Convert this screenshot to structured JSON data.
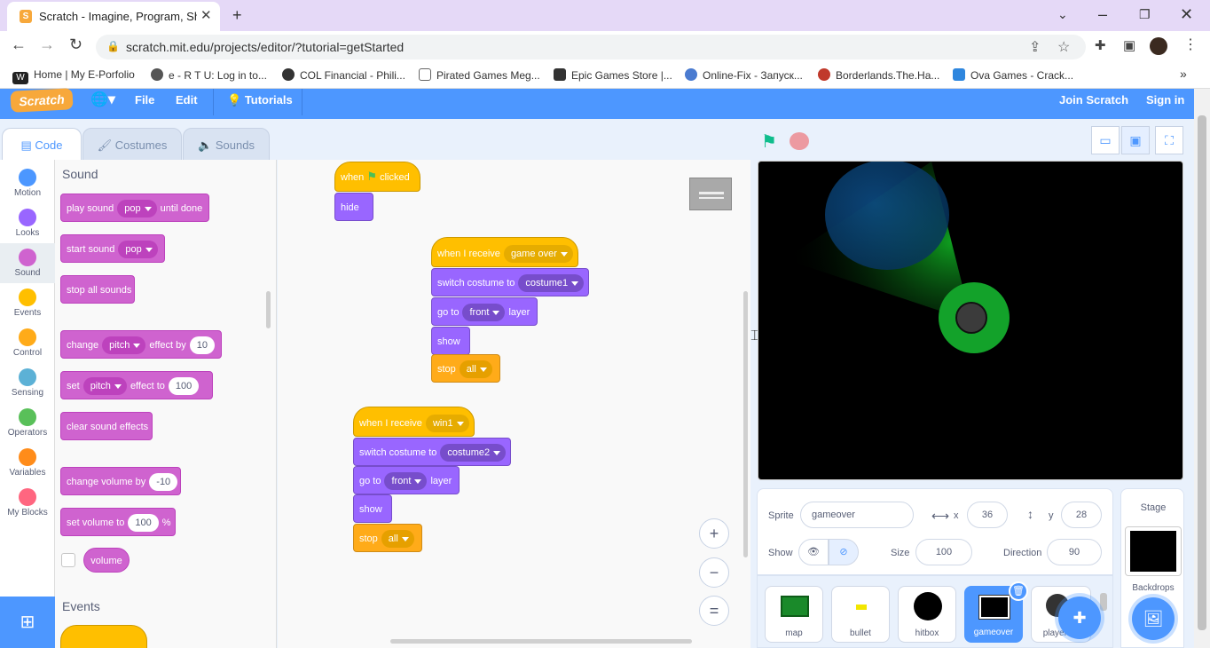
{
  "browser": {
    "tab_title": "Scratch - Imagine, Program, Share",
    "tab_close": "✕",
    "new_tab": "+",
    "url": "scratch.mit.edu/projects/editor/?tutorial=getStarted",
    "bookmarks": [
      {
        "label": "Home | My E-Porfolio",
        "color": "#222"
      },
      {
        "label": "e - R T U: Log in to...",
        "color": "#555"
      },
      {
        "label": "COL Financial - Phili...",
        "color": "#333"
      },
      {
        "label": "Pirated Games Meg...",
        "color": "#666"
      },
      {
        "label": "Epic Games Store |...",
        "color": "#333"
      },
      {
        "label": "Online-Fix - Запуск...",
        "color": "#4a7bd0"
      },
      {
        "label": "Borderlands.The.Ha...",
        "color": "#c0392b"
      },
      {
        "label": "Ova Games - Crack...",
        "color": "#2e86de"
      }
    ]
  },
  "menu": {
    "logo": "Scratch",
    "file": "File",
    "edit": "Edit",
    "tutorials": "Tutorials",
    "join": "Join Scratch",
    "signin": "Sign in"
  },
  "tabs": {
    "code": "Code",
    "costumes": "Costumes",
    "sounds": "Sounds"
  },
  "categories": [
    {
      "label": "Motion",
      "color": "#4c97ff"
    },
    {
      "label": "Looks",
      "color": "#9966ff"
    },
    {
      "label": "Sound",
      "color": "#cf63cf"
    },
    {
      "label": "Events",
      "color": "#ffbf00"
    },
    {
      "label": "Control",
      "color": "#ffab19"
    },
    {
      "label": "Sensing",
      "color": "#5cb1d6"
    },
    {
      "label": "Operators",
      "color": "#59c059"
    },
    {
      "label": "Variables",
      "color": "#ff8c1a"
    },
    {
      "label": "My Blocks",
      "color": "#ff6680"
    }
  ],
  "palette": {
    "sound_header": "Sound",
    "events_header": "Events",
    "play_sound": "play sound",
    "play_sound_opt": "pop",
    "until_done": "until done",
    "start_sound": "start sound",
    "start_sound_opt": "pop",
    "stop_all_sounds": "stop all sounds",
    "change": "change",
    "change_opt": "pitch",
    "effect_by": "effect by",
    "effect_by_val": "10",
    "set": "set",
    "set_opt": "pitch",
    "effect_to": "effect to",
    "effect_to_val": "100",
    "clear_effects": "clear sound effects",
    "change_volume": "change volume by",
    "change_volume_val": "-10",
    "set_volume": "set volume to",
    "set_volume_val": "100",
    "percent": "%",
    "volume": "volume"
  },
  "script1": {
    "when": "when",
    "clicked": "clicked",
    "hide": "hide"
  },
  "script2": {
    "when_receive": "when I receive",
    "msg": "game over",
    "switch": "switch costume to",
    "costume": "costume1",
    "goto": "go to",
    "layer_opt": "front",
    "layer": "layer",
    "show": "show",
    "stop": "stop",
    "stop_opt": "all"
  },
  "script3": {
    "when_receive": "when I receive",
    "msg": "win1",
    "switch": "switch costume to",
    "costume": "costume2",
    "goto": "go to",
    "layer_opt": "front",
    "layer": "layer",
    "show": "show",
    "stop": "stop",
    "stop_opt": "all"
  },
  "zoom": {
    "in": "+",
    "out": "−",
    "reset": "="
  },
  "sprite": {
    "sprite_label": "Sprite",
    "name": "gameover",
    "x_label": "x",
    "x": "36",
    "y_label": "y",
    "y": "28",
    "show_label": "Show",
    "size_label": "Size",
    "size": "100",
    "direction_label": "Direction",
    "direction": "90"
  },
  "sprites": [
    {
      "label": "map"
    },
    {
      "label": "bullet"
    },
    {
      "label": "hitbox"
    },
    {
      "label": "gameover"
    },
    {
      "label": "player sp"
    }
  ],
  "stage_panel": {
    "title": "Stage",
    "backdrops": "Backdrops"
  }
}
